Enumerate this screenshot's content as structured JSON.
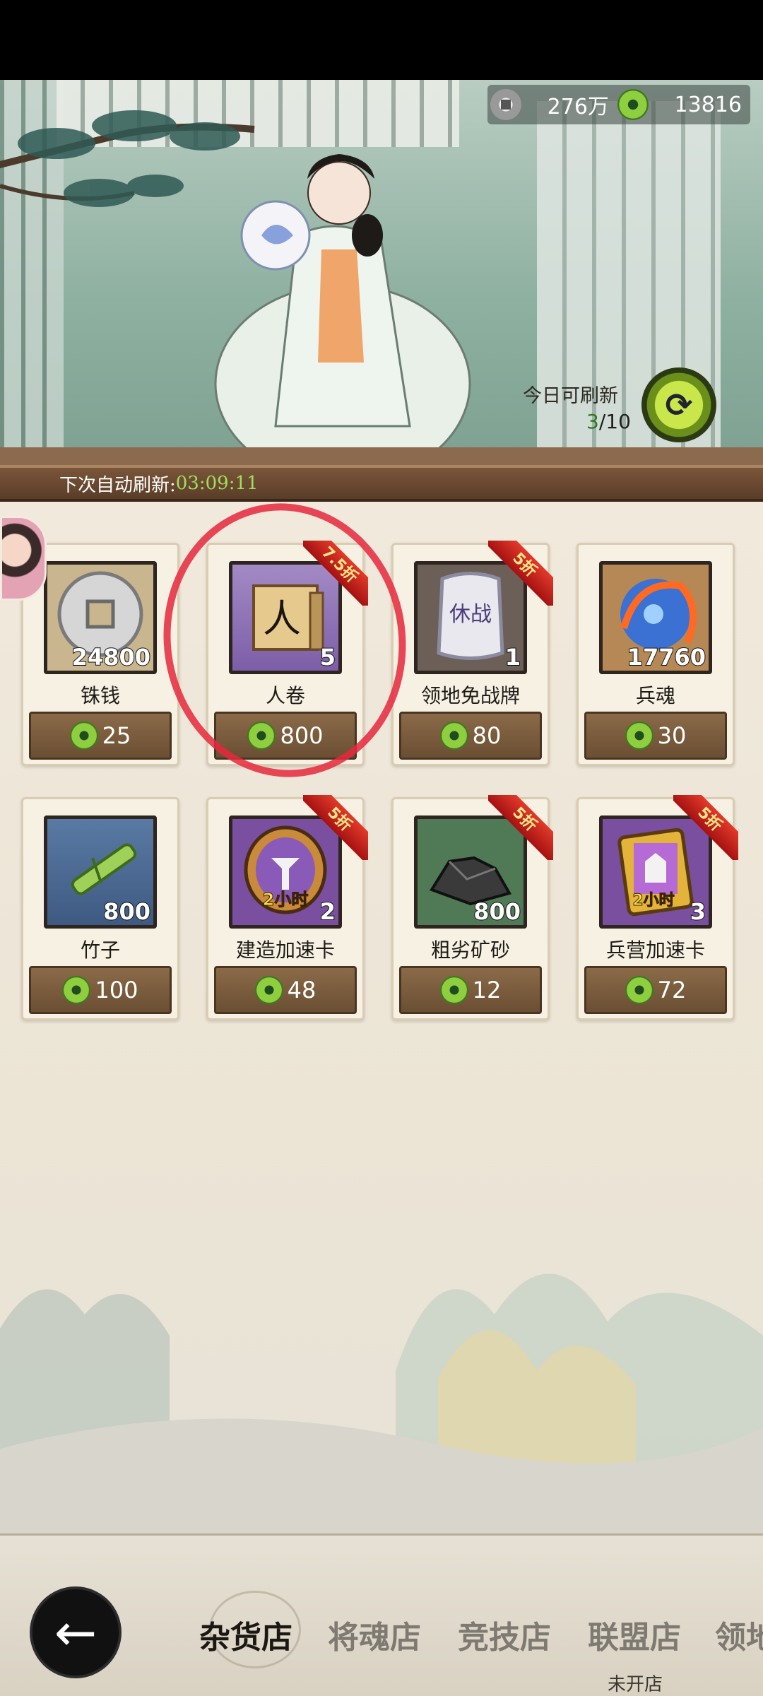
{
  "header": {
    "coins": "276万",
    "jade": "13816",
    "refresh_label": "今日可刷新",
    "refresh_used": "3",
    "refresh_total": "/10",
    "next_refresh_label": "下次自动刷新:",
    "next_refresh_time": "03:09:11"
  },
  "items": [
    {
      "name": "铢钱",
      "qty": "24800",
      "price": "25",
      "discount": ""
    },
    {
      "name": "人卷",
      "qty": "5",
      "price": "800",
      "discount": "7.5折"
    },
    {
      "name": "领地免战牌",
      "qty": "1",
      "price": "80",
      "discount": "5折"
    },
    {
      "name": "兵魂",
      "qty": "17760",
      "price": "30",
      "discount": ""
    },
    {
      "name": "竹子",
      "qty": "800",
      "price": "100",
      "discount": ""
    },
    {
      "name": "建造加速卡",
      "qty": "2",
      "price": "48",
      "discount": "5折"
    },
    {
      "name": "粗劣矿砂",
      "qty": "800",
      "price": "12",
      "discount": "5折"
    },
    {
      "name": "兵营加速卡",
      "qty": "3",
      "price": "72",
      "discount": "5折"
    }
  ],
  "item_art_text": {
    "scroll_char": "人",
    "token_chars": "休战",
    "build_card_text": "2小时",
    "barracks_card_text": "2小时"
  },
  "nav": {
    "back": "←",
    "tabs": [
      "杂货店",
      "将魂店",
      "竞技店",
      "联盟店",
      "领地"
    ],
    "closed_note": "未开店"
  },
  "icons": [
    "coin-icon",
    "jade-icon",
    "refresh-icon",
    "back-arrow-icon"
  ],
  "colors": {
    "accent_green": "#9fe05a",
    "badge_red": "#c21f1a",
    "price_brown": "#7a5a3c"
  }
}
